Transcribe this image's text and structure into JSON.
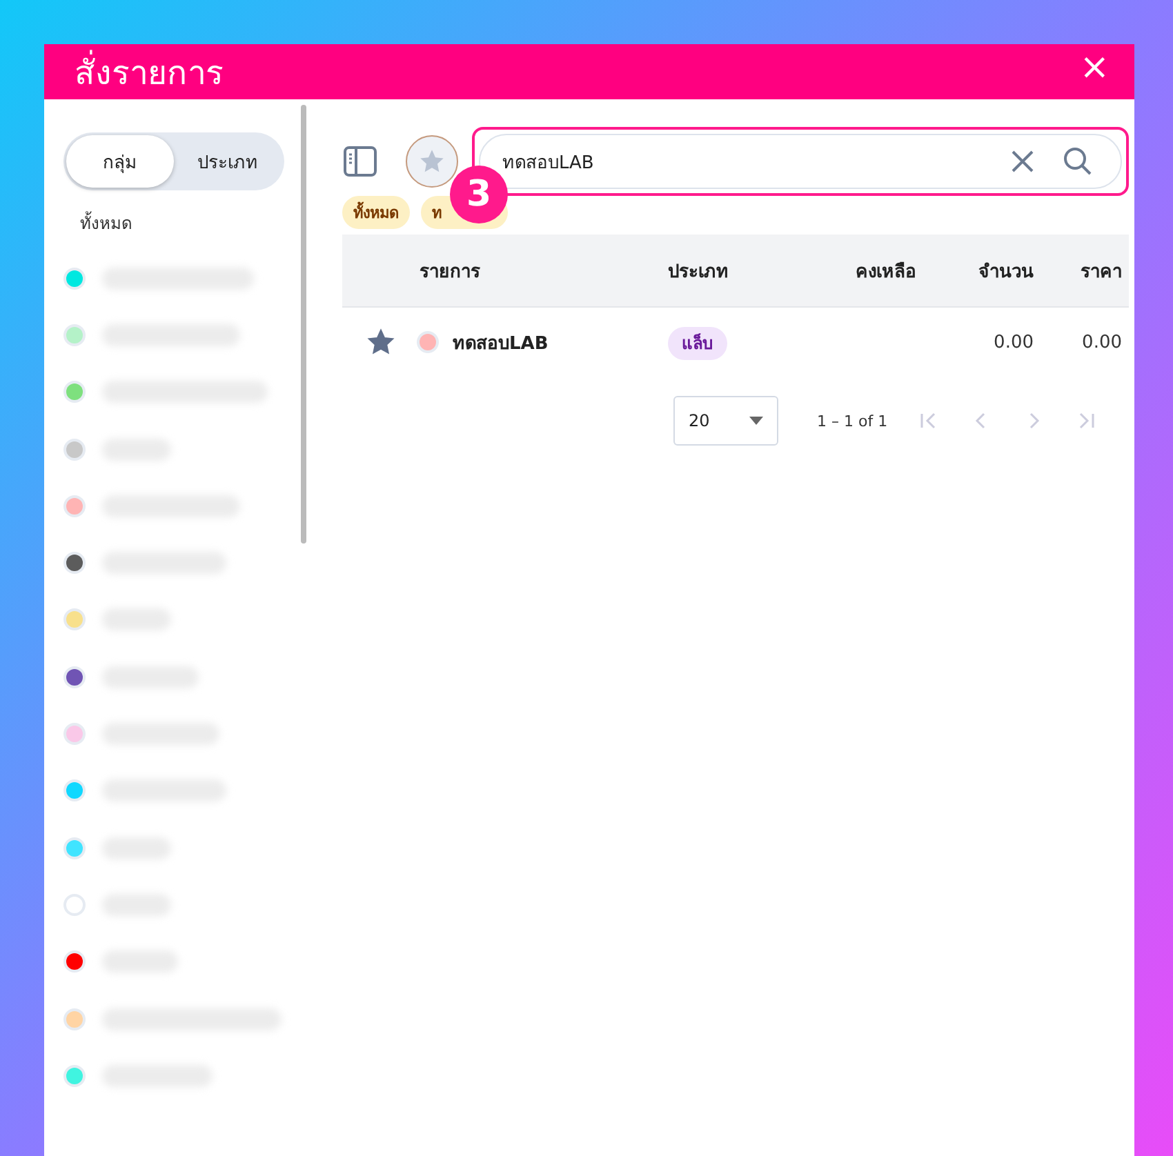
{
  "window": {
    "title": "สั่งรายการ",
    "close": "×"
  },
  "sidebar": {
    "segments": [
      {
        "label": "กลุ่ม",
        "selected": true
      },
      {
        "label": "ประเภท",
        "selected": false
      }
    ],
    "all_label": "ทั้งหมด",
    "items": [
      {
        "color": "#00e8e0"
      },
      {
        "color": "#b4f2c8"
      },
      {
        "color": "#7ee07e"
      },
      {
        "color": "#c8c8c8"
      },
      {
        "color": "#ffb4b4"
      },
      {
        "color": "#5c5c5c"
      },
      {
        "color": "#f8e08c"
      },
      {
        "color": "#7054b4"
      },
      {
        "color": "#fac8e8"
      },
      {
        "color": "#10d8ff"
      },
      {
        "color": "#40e4ff"
      },
      {
        "color": "#ffffff"
      },
      {
        "color": "#ff0000"
      },
      {
        "color": "#ffd4a4"
      },
      {
        "color": "#40f4e0"
      }
    ]
  },
  "search": {
    "value": "ทดสอบLAB",
    "highlighted": true
  },
  "step_badge": "3",
  "filters": [
    {
      "label": "ทั้งหมด"
    },
    {
      "label": "ท"
    }
  ],
  "table": {
    "columns": [
      "รายการ",
      "ประเภท",
      "คงเหลือ",
      "จำนวน",
      "ราคา"
    ],
    "rows": [
      {
        "favorite": true,
        "color": "#ffb4b4",
        "name": "ทดสอบLAB",
        "type": "แล็บ",
        "remaining": "",
        "quantity": "0.00",
        "price": "0.00"
      }
    ]
  },
  "pagination": {
    "page_size": "20",
    "range": "1 – 1 of 1"
  }
}
